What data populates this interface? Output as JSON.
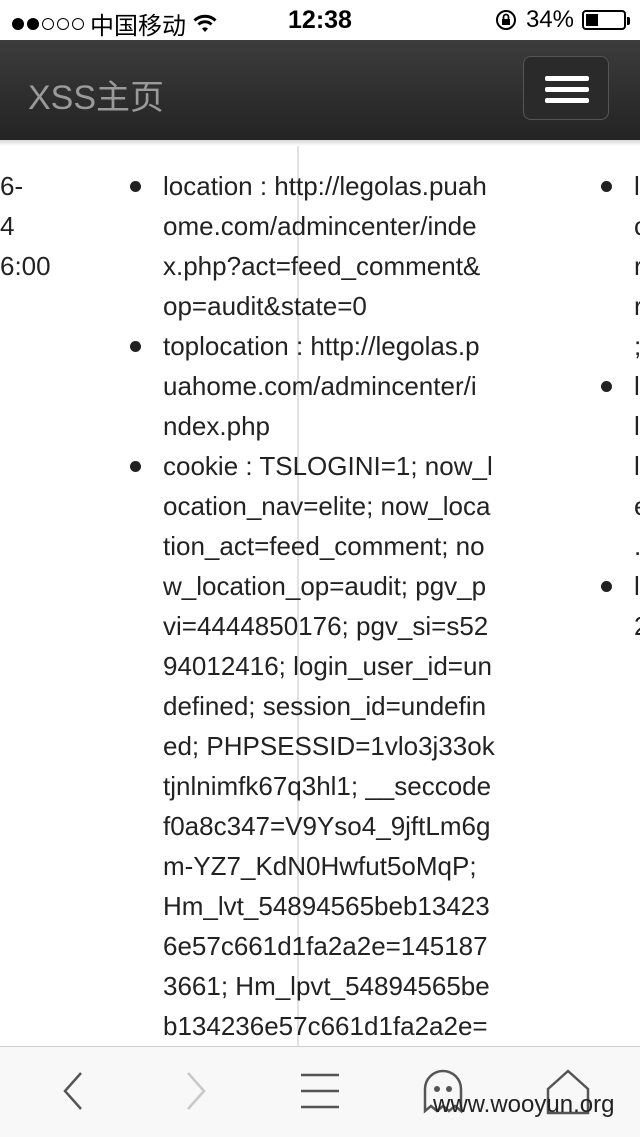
{
  "status_bar": {
    "carrier": "中国移动",
    "time": "12:38",
    "battery_percent": "34%",
    "battery_level": 0.34,
    "signal_bars_filled": 2,
    "signal_bars_total": 5
  },
  "navbar": {
    "brand": "XSS主页"
  },
  "left_fragments": [
    "6-",
    "4",
    "6:00"
  ],
  "main_items": [
    {
      "lines": [
        "location : http://legolas.puah",
        "ome.com/admincenter/inde",
        "x.php?act=feed_comment&",
        "op=audit&state=0"
      ]
    },
    {
      "lines": [
        "toplocation : http://legolas.p",
        "uahome.com/admincenter/i",
        "ndex.php"
      ]
    },
    {
      "lines": [
        "cookie : TSLOGINI=1; now_l",
        "ocation_nav=elite; now_loca",
        "tion_act=feed_comment; no",
        "w_location_op=audit; pgv_p",
        "vi=4444850176; pgv_si=s52",
        "94012416; login_user_id=un",
        "defined; session_id=undefin",
        "ed; PHPSESSID=1vlo3j33ok",
        "tjnlnimfk67q3hl1; __seccode",
        "f0a8c347=V9Yso4_9jftLm6g",
        "m-YZ7_KdN0Hwfut5oMqP;",
        "Hm_lvt_54894565beb13423",
        "6e57c661d1fa2a2e=145187",
        "3661; Hm_lpvt_54894565be",
        "b134236e57c661d1fa2a2e="
      ]
    }
  ],
  "right_items": [
    {
      "lines": [
        "l",
        "c",
        "r",
        "r",
        ";"
      ]
    },
    {
      "lines": [
        "l",
        "l",
        "l",
        "e",
        "."
      ]
    },
    {
      "lines": [
        "l",
        "2"
      ]
    }
  ],
  "toolbar": {
    "back_icon": "chevron-left-icon",
    "forward_icon": "chevron-right-icon",
    "menu_icon": "menu-icon",
    "ghost_icon": "ghost-icon",
    "home_icon": "home-icon"
  },
  "watermark": "www.wooyun.org"
}
